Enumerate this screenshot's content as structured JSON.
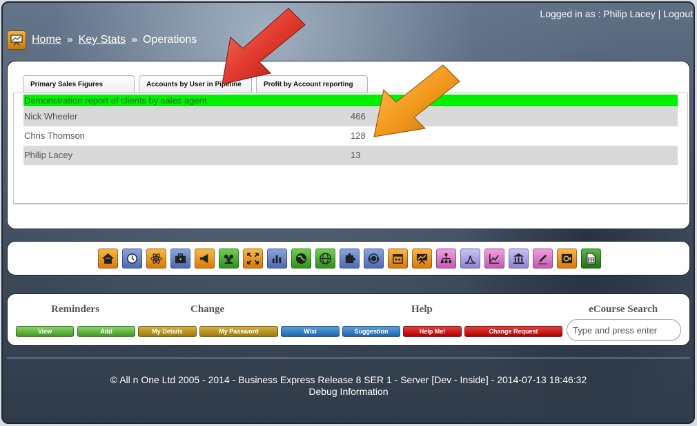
{
  "header": {
    "login_prefix": "Logged in as : Philip Lacey",
    "separator": "|",
    "logout_label": "Logout"
  },
  "breadcrumb": {
    "home": "Home",
    "sep1": "»",
    "keystats": "Key Stats",
    "sep2": "»",
    "current": "Operations"
  },
  "tabs": [
    {
      "label": "Primary Sales Figures"
    },
    {
      "label": "Accounts by User in Pipeline"
    },
    {
      "label": "Profit by Account reporting"
    }
  ],
  "report": {
    "title": "Demonstration report of clients by sales agent.",
    "rows": [
      {
        "name": "Nick Wheeler",
        "value": "466"
      },
      {
        "name": "Chris Thomson",
        "value": "128"
      },
      {
        "name": "Philip Lacey",
        "value": "13"
      }
    ]
  },
  "toolbar_icons": [
    {
      "name": "home-icon",
      "color": "orange"
    },
    {
      "name": "clock-icon",
      "color": "blue"
    },
    {
      "name": "atom-icon",
      "color": "orange"
    },
    {
      "name": "briefcase-icon",
      "color": "blue"
    },
    {
      "name": "megaphone-icon",
      "color": "orange"
    },
    {
      "name": "users-icon",
      "color": "green"
    },
    {
      "name": "expand-icon",
      "color": "orange"
    },
    {
      "name": "bar-chart-icon",
      "color": "blue"
    },
    {
      "name": "globe-dark-icon",
      "color": "green"
    },
    {
      "name": "globe-icon",
      "color": "green"
    },
    {
      "name": "puzzle-icon",
      "color": "blue"
    },
    {
      "name": "support-headset-icon",
      "color": "blue"
    },
    {
      "name": "calendar-icon",
      "color": "orange"
    },
    {
      "name": "presentation-icon",
      "color": "orange"
    },
    {
      "name": "hierarchy-icon",
      "color": "pink"
    },
    {
      "name": "bell-curve-icon",
      "color": "lav"
    },
    {
      "name": "line-chart-icon",
      "color": "pink"
    },
    {
      "name": "bank-icon",
      "color": "lav"
    },
    {
      "name": "pen-icon",
      "color": "pink"
    },
    {
      "name": "safe-icon",
      "color": "orange"
    },
    {
      "name": "spreadsheet-icon",
      "color": "dkgreen"
    }
  ],
  "footer_panel": {
    "reminders_title": "Reminders",
    "change_title": "Change",
    "help_title": "Help",
    "ecourse_title": "eCourse Search",
    "buttons": {
      "view": "View",
      "add": "Add",
      "my_details": "My Details",
      "my_password": "My Password",
      "wixi": "Wixi",
      "suggestion": "Suggestion",
      "help_me": "Help Me!",
      "change_request": "Change Request"
    },
    "search_placeholder": "Type and press enter"
  },
  "copyright": {
    "line1": "© All n One Ltd 2005 - 2014 - Business Express Release 8 SER 1 - Server [Dev - Inside] - 2014-07-13 18:46:32",
    "line2": "Debug Information"
  },
  "annotations": {
    "red_arrow_color": "#e23a2e",
    "orange_arrow_color": "#f39a1e"
  }
}
